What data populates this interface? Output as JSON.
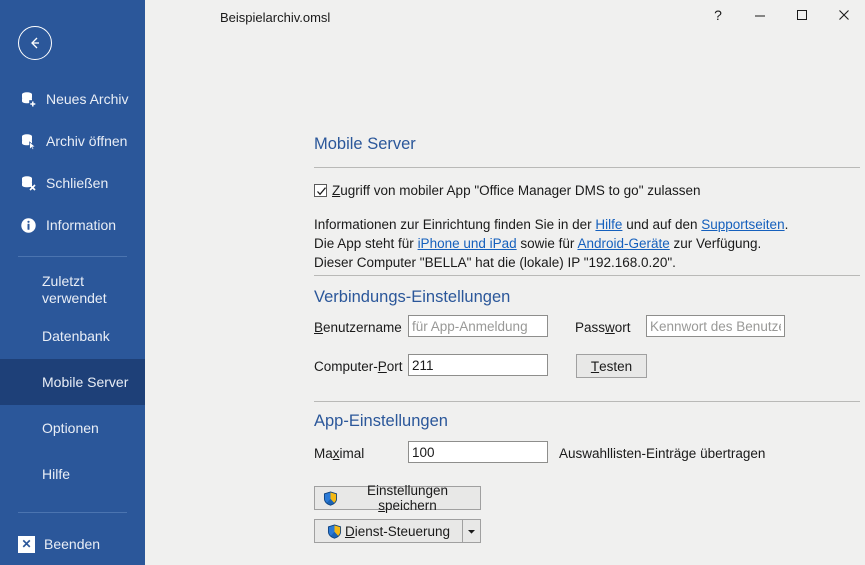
{
  "window": {
    "title": "Beispielarchiv.omsl",
    "help_label": "?",
    "minimize_label": "–",
    "maximize_label": "☐",
    "close_label": "✕"
  },
  "sidebar": {
    "back_icon": "back-arrow-icon",
    "items": [
      {
        "label": "Neues Archiv",
        "icon": "database-add-icon"
      },
      {
        "label": "Archiv öffnen",
        "icon": "database-open-icon"
      },
      {
        "label": "Schließen",
        "icon": "database-close-icon"
      },
      {
        "label": "Information",
        "icon": "info-icon"
      }
    ],
    "pages": [
      {
        "label": "Zuletzt",
        "label2": "verwendet",
        "selected": false
      },
      {
        "label": "Datenbank",
        "selected": false
      },
      {
        "label": "Mobile Server",
        "selected": true
      },
      {
        "label": "Optionen",
        "selected": false
      },
      {
        "label": "Hilfe",
        "selected": false
      }
    ],
    "exit": {
      "label": "Beenden",
      "icon": "exit-x-icon",
      "glyph": "✕"
    },
    "colors": {
      "bg": "#2b579a",
      "selected_bg": "#1e4078",
      "text": "#e9eef6"
    }
  },
  "page": {
    "heading": "Mobile Server",
    "checkbox": {
      "checked": true,
      "label_key": "Z",
      "label_rest": "ugriff von mobiler App \"Office Manager DMS to go\" zulassen"
    },
    "info": {
      "line1_a": "Informationen zur Einrichtung finden Sie in der ",
      "line1_link1": "Hilfe",
      "line1_b": " und auf den ",
      "line1_link2": "Supportseiten",
      "line1_c": ".",
      "line2_a": "Die App steht für ",
      "line2_link1": "iPhone und iPad",
      "line2_b": " sowie für ",
      "line2_link2": "Android-Geräte",
      "line2_c": " zur Verfügung.",
      "line3": "Dieser Computer \"BELLA\" hat die (lokale) IP \"192.168.0.20\"."
    },
    "connection": {
      "heading": "Verbindungs-Einstellungen",
      "username": {
        "label_key": "B",
        "label_rest": "enutzername",
        "value": "",
        "placeholder": "für App-Anmeldung"
      },
      "password": {
        "label_a": "Pass",
        "label_key": "w",
        "label_b": "ort",
        "value": "",
        "placeholder": "Kennwort des Benutzers"
      },
      "port": {
        "label_a": "Computer-",
        "label_key": "P",
        "label_b": "ort",
        "value": "211",
        "placeholder": ""
      },
      "test_button": {
        "label_key": "T",
        "label_rest": "esten"
      }
    },
    "app_settings": {
      "heading": "App-Einstellungen",
      "maximal": {
        "label_a": "Ma",
        "label_key": "x",
        "label_b": "imal",
        "value": "100",
        "placeholder": ""
      },
      "maximal_suffix": "Auswahllisten-Einträge übertragen",
      "save_button": {
        "icon": "uac-shield-icon",
        "label_a": "Einstellungen ",
        "label_key": "s",
        "label_b": "peichern"
      },
      "service_button": {
        "icon": "uac-shield-icon",
        "label_key": "D",
        "label_rest": "ienst-Steuerung",
        "dropdown_icon": "chevron-down-icon"
      }
    },
    "colors": {
      "accent": "#2b579a",
      "link": "#1560bd",
      "bg": "#f0f0ef"
    }
  }
}
